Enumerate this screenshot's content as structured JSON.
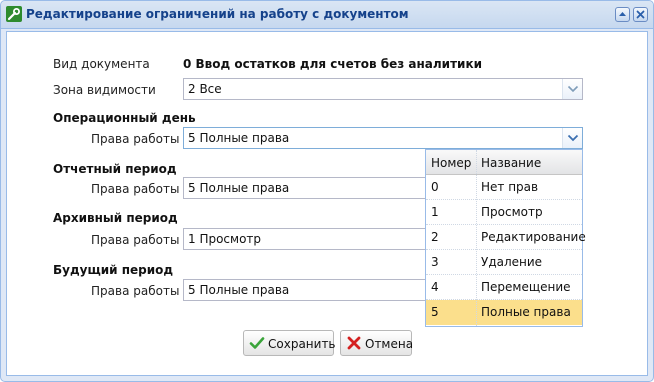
{
  "window": {
    "title": "Редактирование ограничений на работу с документом",
    "icon": "edit-wrench-icon"
  },
  "document": {
    "label": "Вид документа",
    "value": "0 Ввод остатков для счетов без аналитики"
  },
  "visibility": {
    "label": "Зона видимости",
    "value": "2 Все"
  },
  "sections": [
    {
      "title": "Операционный день",
      "rights_label": "Права работы",
      "rights_value": "5 Полные права"
    },
    {
      "title": "Отчетный период",
      "rights_label": "Права работы",
      "rights_value": "5 Полные права"
    },
    {
      "title": "Архивный период",
      "rights_label": "Права работы",
      "rights_value": "1 Просмотр"
    },
    {
      "title": "Будущий период",
      "rights_label": "Права работы",
      "rights_value": "5 Полные права"
    }
  ],
  "dropdown": {
    "headers": [
      "Номер",
      "Название"
    ],
    "rows": [
      {
        "num": "0",
        "name": "Нет прав"
      },
      {
        "num": "1",
        "name": "Просмотр"
      },
      {
        "num": "2",
        "name": "Редактирование"
      },
      {
        "num": "3",
        "name": "Удаление"
      },
      {
        "num": "4",
        "name": "Перемещение"
      },
      {
        "num": "5",
        "name": "Полные права"
      }
    ],
    "selected_index": 5
  },
  "buttons": {
    "save": "Сохранить",
    "cancel": "Отмена"
  },
  "colors": {
    "selected_row": "#fbdf8c",
    "title_text": "#15428b",
    "save_icon": "#3aa43a",
    "cancel_icon": "#d42020"
  }
}
